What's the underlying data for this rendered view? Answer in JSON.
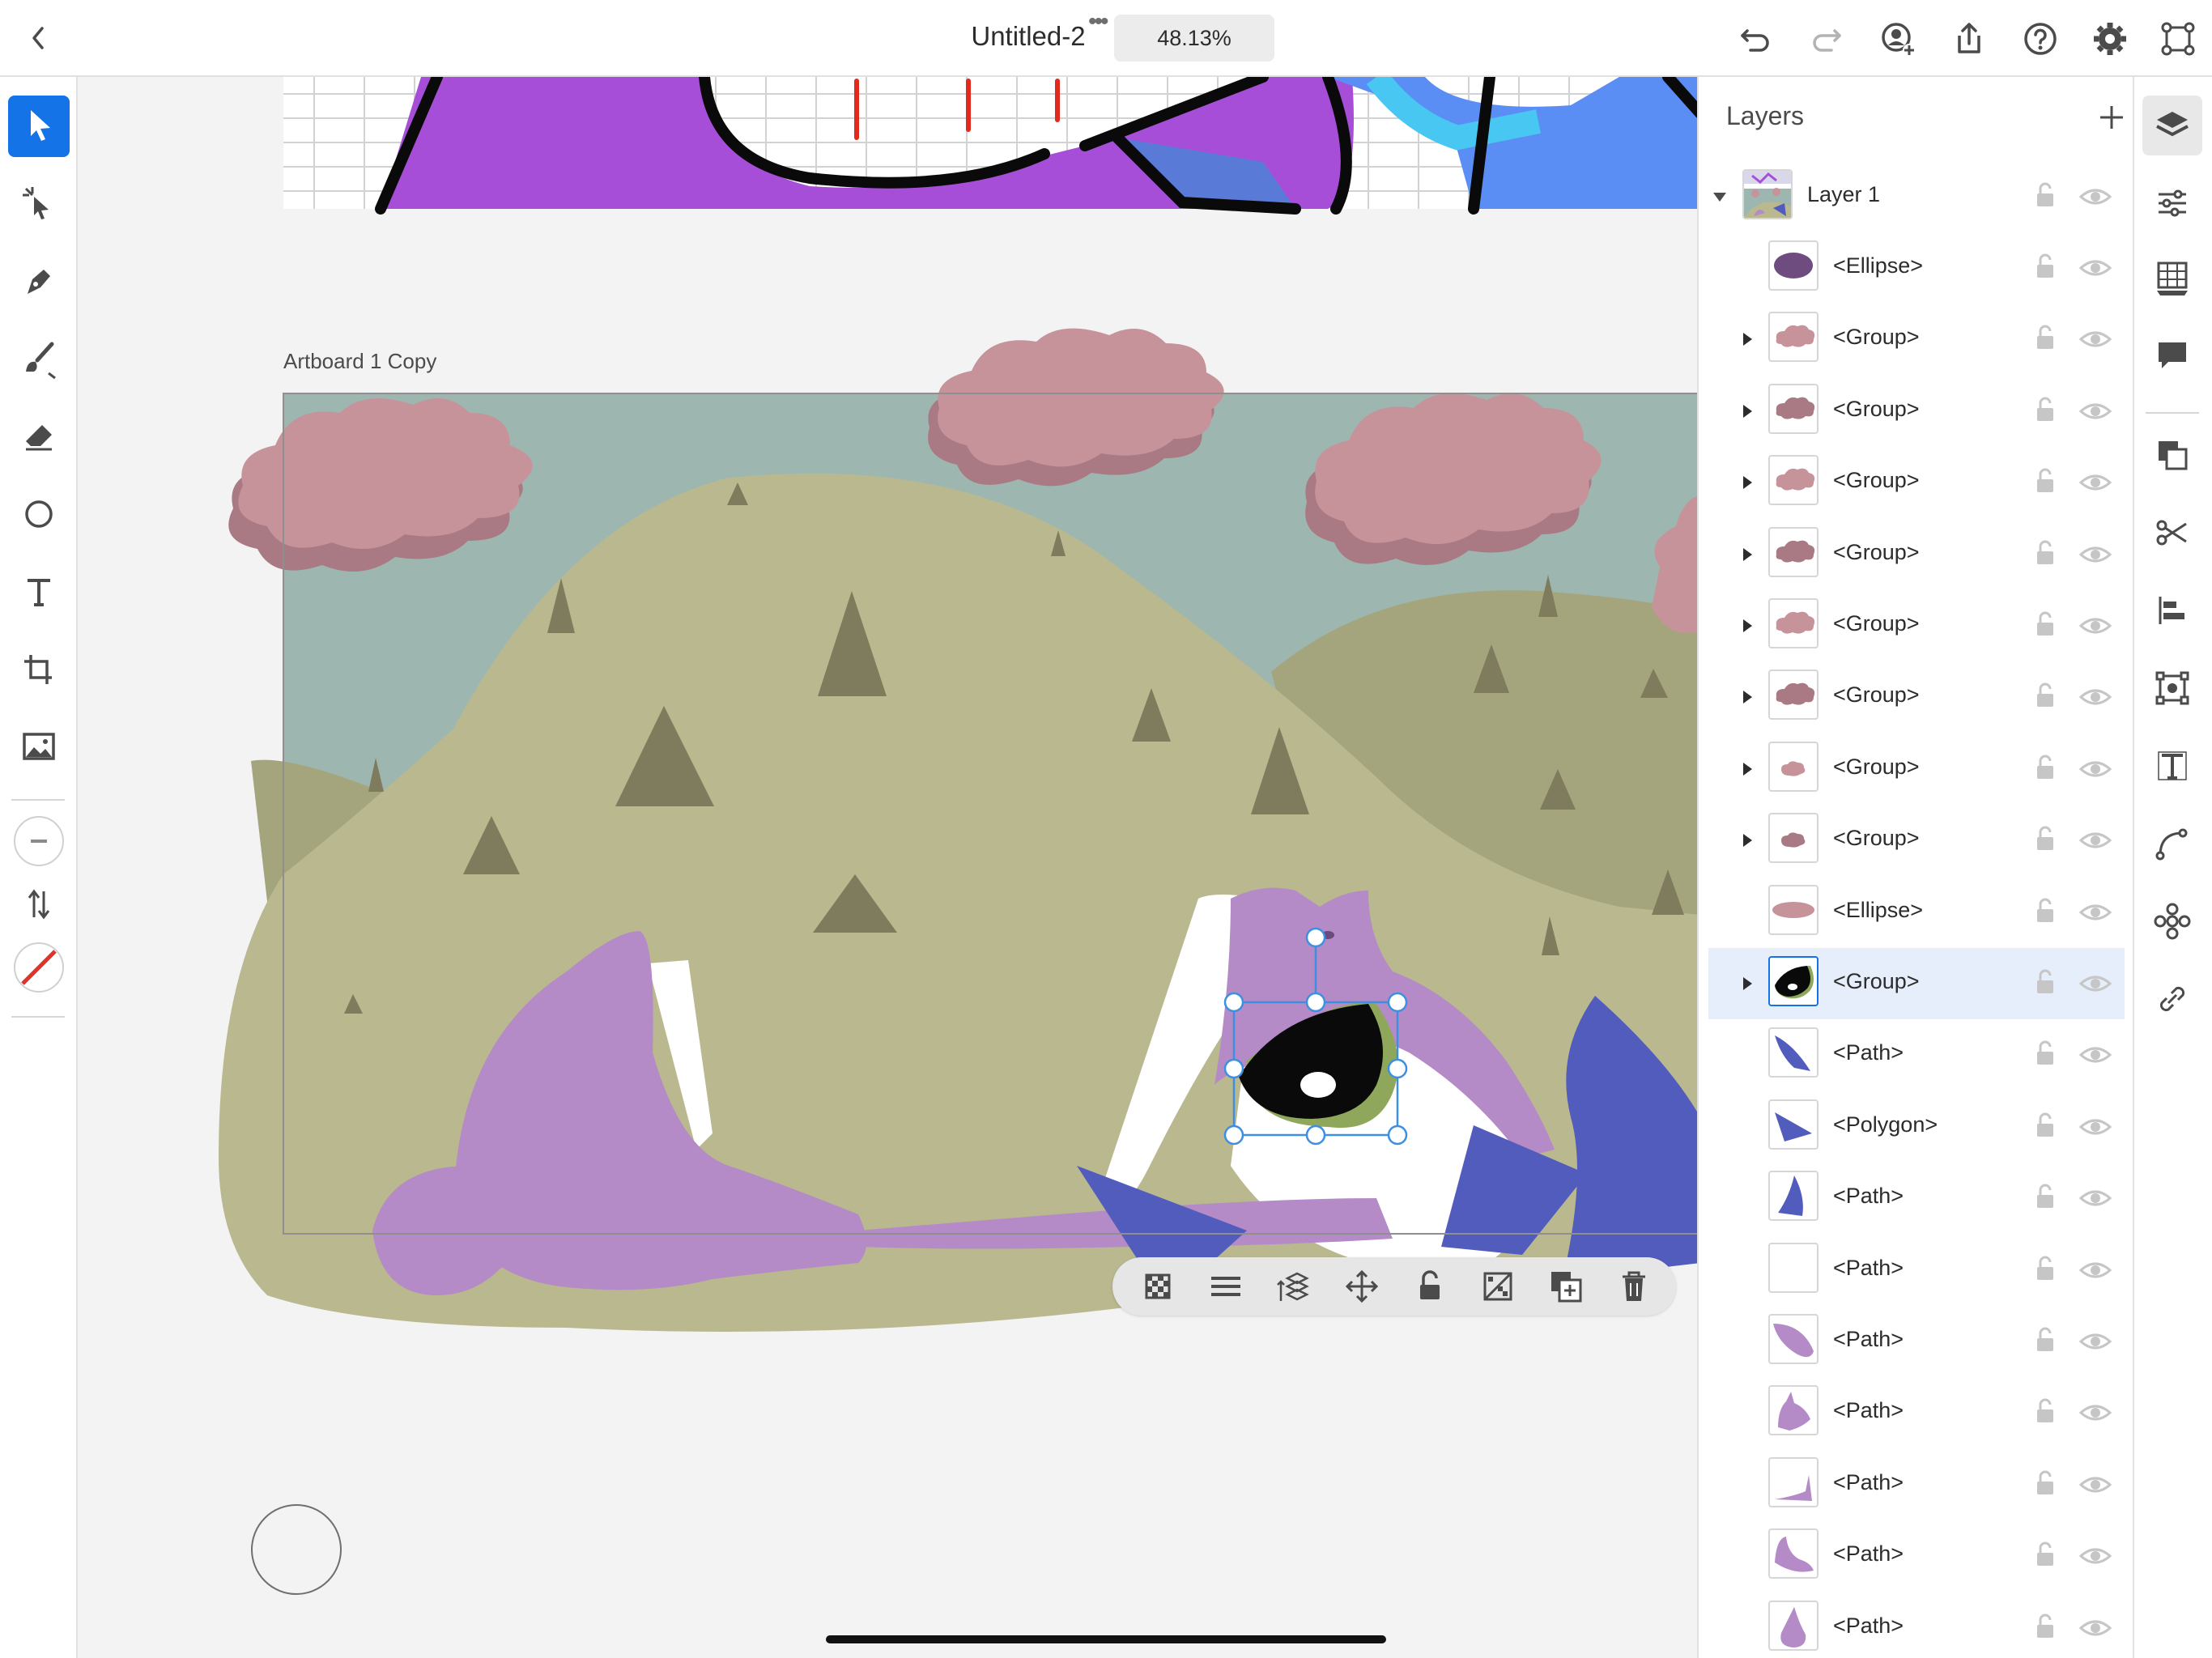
{
  "document": {
    "title": "Untitled-2",
    "zoom": "48.13%"
  },
  "artboard": {
    "label": "Artboard 1 Copy"
  },
  "topbar": {
    "icons": [
      "back-icon",
      "undo-icon",
      "redo-icon",
      "invite-user-icon",
      "share-icon",
      "help-icon",
      "settings-icon",
      "artboard-icon"
    ]
  },
  "tools": [
    "selection-tool",
    "direct-selection-tool",
    "pen-tool",
    "paint-brush-tool",
    "eraser-tool",
    "ellipse-tool",
    "type-tool",
    "crop-tool",
    "place-image-tool",
    "fill-stroke",
    "swap-fill-stroke",
    "no-stroke"
  ],
  "layers_panel": {
    "title": "Layers",
    "parent": {
      "name": "Layer 1"
    },
    "items": [
      {
        "name": "<Ellipse>",
        "thumb": "ellipse-dark",
        "expandable": false
      },
      {
        "name": "<Group>",
        "thumb": "cloud-light",
        "expandable": true
      },
      {
        "name": "<Group>",
        "thumb": "cloud-dark",
        "expandable": true
      },
      {
        "name": "<Group>",
        "thumb": "cloud-light",
        "expandable": true
      },
      {
        "name": "<Group>",
        "thumb": "cloud-dark",
        "expandable": true
      },
      {
        "name": "<Group>",
        "thumb": "cloud-light",
        "expandable": true
      },
      {
        "name": "<Group>",
        "thumb": "cloud-dark",
        "expandable": true
      },
      {
        "name": "<Group>",
        "thumb": "cloud-small",
        "expandable": true
      },
      {
        "name": "<Group>",
        "thumb": "cloud-small-dark",
        "expandable": true
      },
      {
        "name": "<Ellipse>",
        "thumb": "ellipse-pink",
        "expandable": false
      },
      {
        "name": "<Group>",
        "thumb": "eye",
        "expandable": true,
        "selected": true
      },
      {
        "name": "<Path>",
        "thumb": "blue-wedge",
        "expandable": false
      },
      {
        "name": "<Polygon>",
        "thumb": "blue-triangle",
        "expandable": false
      },
      {
        "name": "<Path>",
        "thumb": "blue-fin",
        "expandable": false
      },
      {
        "name": "<Path>",
        "thumb": "blank",
        "expandable": false
      },
      {
        "name": "<Path>",
        "thumb": "purple-leaf",
        "expandable": false
      },
      {
        "name": "<Path>",
        "thumb": "purple-body",
        "expandable": false
      },
      {
        "name": "<Path>",
        "thumb": "purple-strip",
        "expandable": false
      },
      {
        "name": "<Path>",
        "thumb": "purple-blob",
        "expandable": false
      },
      {
        "name": "<Path>",
        "thumb": "purple-drop",
        "expandable": false
      }
    ]
  },
  "context_bar": {
    "actions": [
      "opacity-icon",
      "stroke-menu-icon",
      "arrange-icon",
      "move-icon",
      "lock-icon",
      "mask-icon",
      "duplicate-icon",
      "delete-icon"
    ]
  },
  "colors": {
    "accent": "#1473e6",
    "sky": "#9db7b0",
    "hill": "#b9b88f",
    "hill_dark": "#a5a57d",
    "tree": "#7f7b5d",
    "cloud": "#c7939a",
    "cloud_shadow": "#a97a83",
    "purple": "#b48bc7",
    "blue": "#525cbd",
    "eye_green": "#8fa75a"
  }
}
